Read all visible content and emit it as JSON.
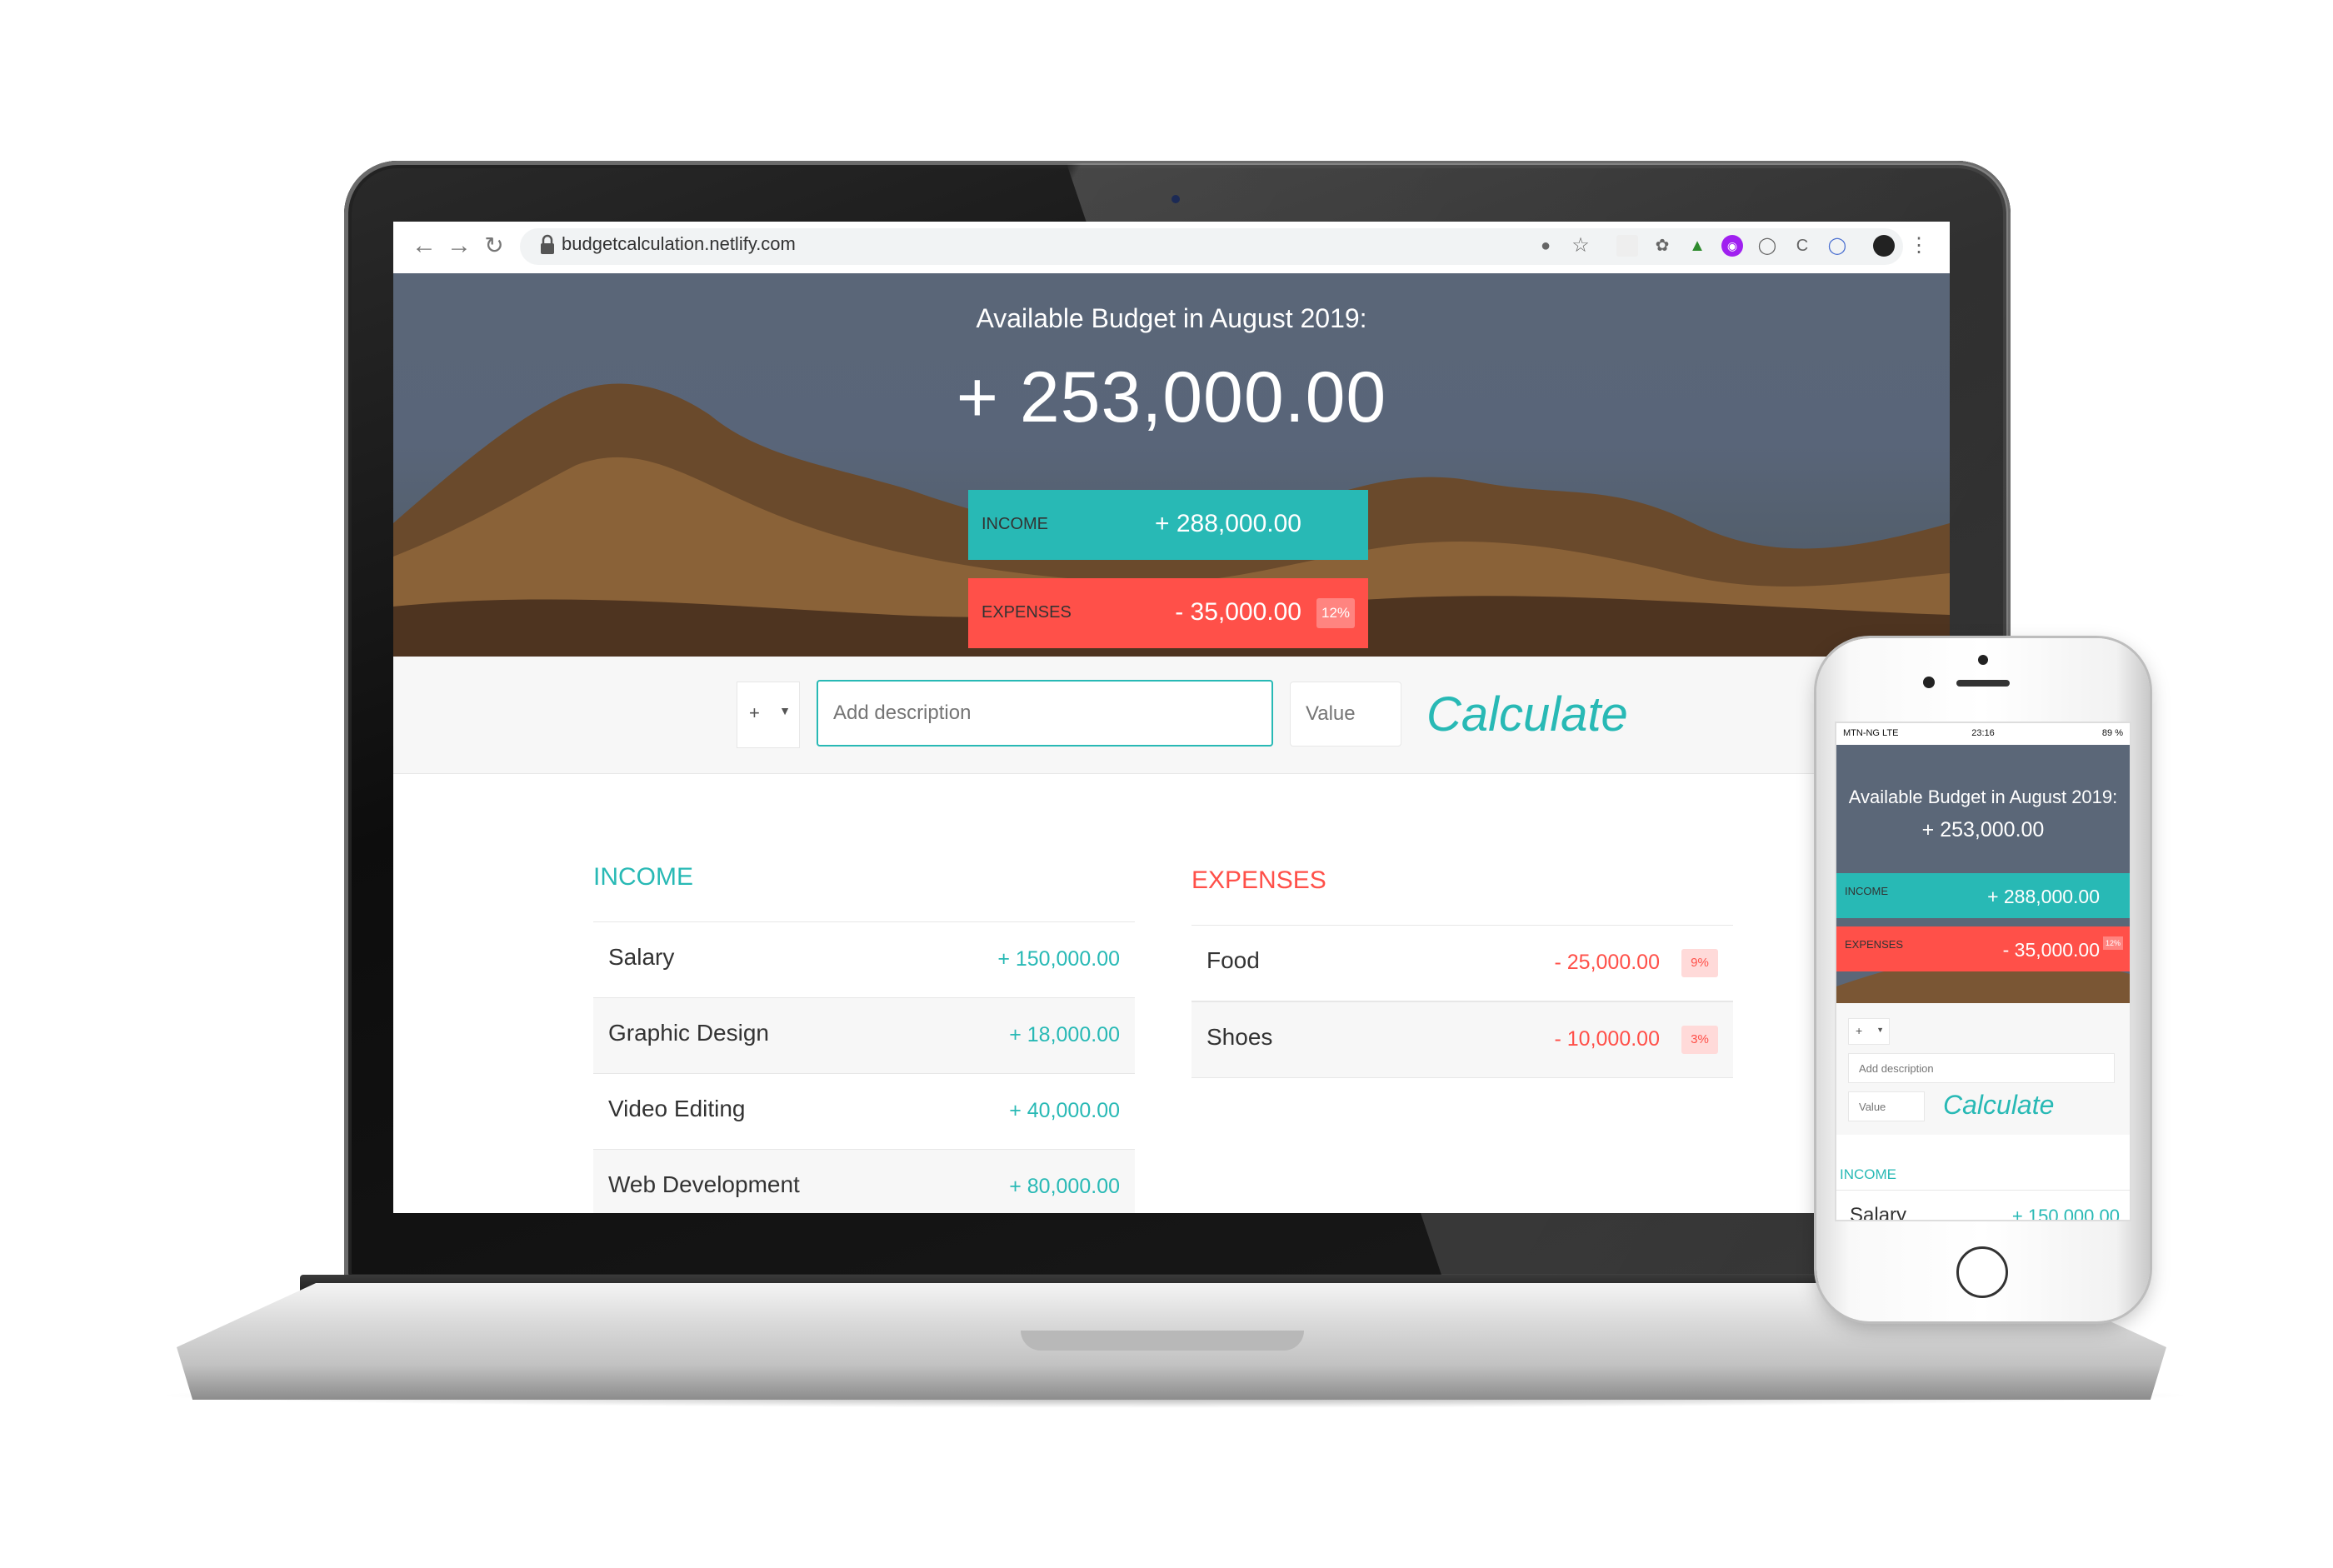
{
  "browser": {
    "url": "budgetcalculation.netlify.com",
    "back_icon": "arrow-left-icon",
    "forward_icon": "arrow-right-icon",
    "reload_icon": "reload-icon"
  },
  "hero": {
    "title": "Available Budget in August 2019:",
    "amount": "+ 253,000.00",
    "income_label": "INCOME",
    "income_value": "+ 288,000.00",
    "expenses_label": "EXPENSES",
    "expenses_value": "- 35,000.00",
    "expenses_percentage": "12%"
  },
  "add_form": {
    "type_symbol": "+",
    "description_placeholder": "Add description",
    "value_placeholder": "Value",
    "calculate_label": "Calculate"
  },
  "income": {
    "heading": "INCOME",
    "items": [
      {
        "description": "Salary",
        "value": "+ 150,000.00"
      },
      {
        "description": "Graphic Design",
        "value": "+ 18,000.00"
      },
      {
        "description": "Video Editing",
        "value": "+ 40,000.00"
      },
      {
        "description": "Web Development",
        "value": "+ 80,000.00"
      }
    ]
  },
  "expenses": {
    "heading": "EXPENSES",
    "items": [
      {
        "description": "Food",
        "value": "- 25,000.00",
        "percentage": "9%"
      },
      {
        "description": "Shoes",
        "value": "- 10,000.00",
        "percentage": "3%"
      }
    ]
  },
  "phone": {
    "carrier": "MTN-NG  LTE",
    "time": "23:16",
    "battery": "89 %",
    "title": "Available Budget in August 2019:",
    "amount": "+ 253,000.00",
    "income_label": "INCOME",
    "income_value": "+ 288,000.00",
    "expenses_label": "EXPENSES",
    "expenses_value": "- 35,000.00",
    "expenses_percentage": "12%",
    "type_symbol": "+",
    "description_placeholder": "Add description",
    "value_placeholder": "Value",
    "calculate_label": "Calculate",
    "income_heading": "INCOME",
    "first_item": {
      "description": "Salary",
      "value": "+ 150,000.00"
    }
  },
  "colors": {
    "income": "#28b9b5",
    "expenses": "#ff5049",
    "hero_sky": "#5a6678"
  }
}
